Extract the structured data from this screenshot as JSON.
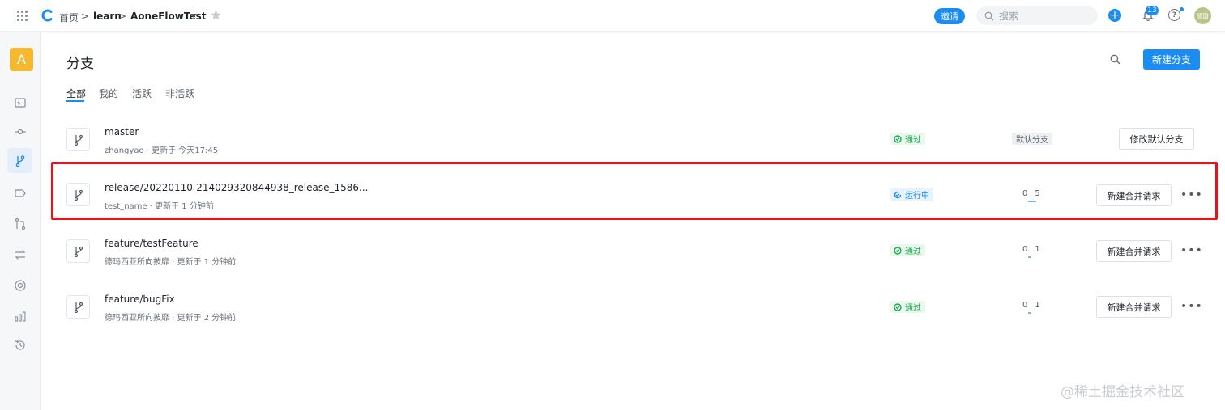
{
  "topbar": {
    "breadcrumb_home": "首页",
    "breadcrumb_sep": ">",
    "breadcrumb_group": "learn",
    "breadcrumb_repo": "AoneFlowTest",
    "invite_label": "邀请",
    "search_placeholder": "搜索",
    "notification_count": "13",
    "help_label": "?",
    "avatar_label": "德国"
  },
  "sidebar": {
    "project_initial": "A"
  },
  "page": {
    "title": "分支",
    "new_branch_label": "新建分支",
    "tabs": [
      {
        "label": "全部",
        "active": true
      },
      {
        "label": "我的",
        "active": false
      },
      {
        "label": "活跃",
        "active": false
      },
      {
        "label": "非活跃",
        "active": false
      }
    ]
  },
  "branches": [
    {
      "name": "master",
      "meta": "zhangyao · 更新于 今天17:45",
      "status": "通过",
      "default_tag": "默认分支",
      "action_label": "修改默认分支"
    },
    {
      "name": "release/20220110-214029320844938_release_1586...",
      "meta": "test_name · 更新于 1 分钟前",
      "status": "运行中",
      "behind": "0",
      "ahead": "5",
      "action_label": "新建合并请求",
      "more_label": "•••"
    },
    {
      "name": "feature/testFeature",
      "meta": "德玛西亚所向披靡 · 更新于 1 分钟前",
      "status": "通过",
      "behind": "0",
      "ahead": "1",
      "action_label": "新建合并请求",
      "more_label": "•••"
    },
    {
      "name": "feature/bugFix",
      "meta": "德玛西亚所向披靡 · 更新于 2 分钟前",
      "status": "通过",
      "behind": "0",
      "ahead": "1",
      "action_label": "新建合并请求",
      "more_label": "•••"
    }
  ],
  "watermark": "@稀土掘金技术社区",
  "colors": {
    "accent": "#1b8cf2",
    "pass": "#1ba94c",
    "highlight": "#e8121a",
    "project_badge": "#f5b82e"
  }
}
